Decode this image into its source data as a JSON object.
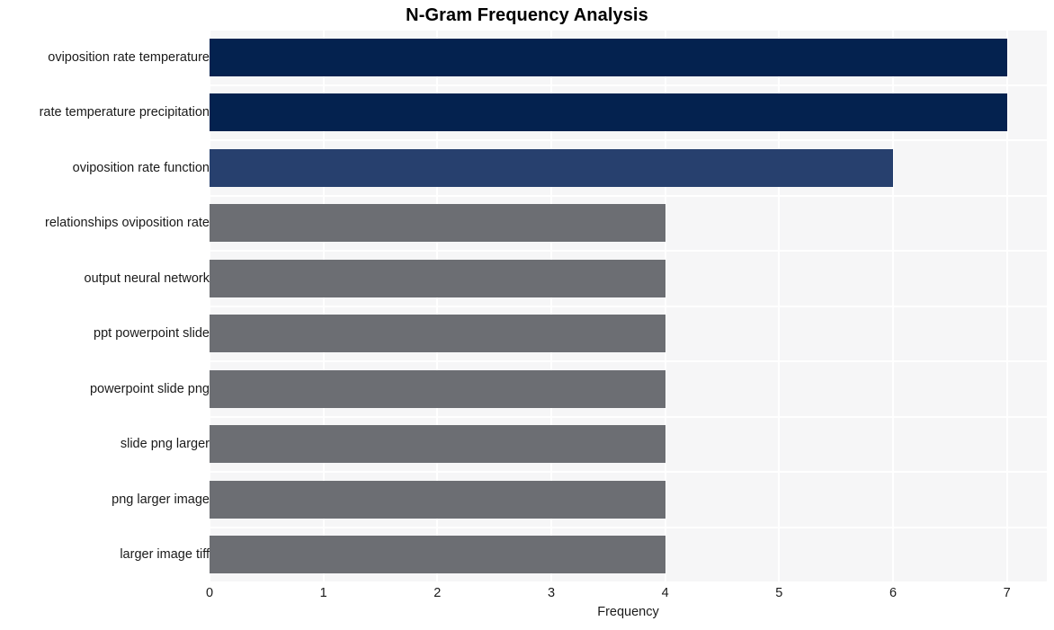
{
  "chart_data": {
    "type": "bar",
    "orientation": "horizontal",
    "title": "N-Gram Frequency Analysis",
    "xlabel": "Frequency",
    "ylabel": "",
    "xlim": [
      0,
      7.35
    ],
    "xticks": [
      0,
      1,
      2,
      3,
      4,
      5,
      6,
      7
    ],
    "xtick_labels": [
      "0",
      "1",
      "2",
      "3",
      "4",
      "5",
      "6",
      "7"
    ],
    "grid": true,
    "legend": "none",
    "categories": [
      "oviposition rate temperature",
      "rate temperature precipitation",
      "oviposition rate function",
      "relationships oviposition rate",
      "output neural network",
      "ppt powerpoint slide",
      "powerpoint slide png",
      "slide png larger",
      "png larger image",
      "larger image tiff"
    ],
    "values": [
      7,
      7,
      6,
      4,
      4,
      4,
      4,
      4,
      4,
      4
    ],
    "bar_colors": [
      "#04224f",
      "#04224f",
      "#27406e",
      "#6c6e73",
      "#6c6e73",
      "#6c6e73",
      "#6c6e73",
      "#6c6e73",
      "#6c6e73",
      "#6c6e73"
    ]
  },
  "style": {
    "plot_background": "#f6f6f7",
    "figure_background": "#ffffff",
    "gridline_color": "#ffffff",
    "text_color": "#1a1a1a",
    "title_color": "#000000"
  }
}
